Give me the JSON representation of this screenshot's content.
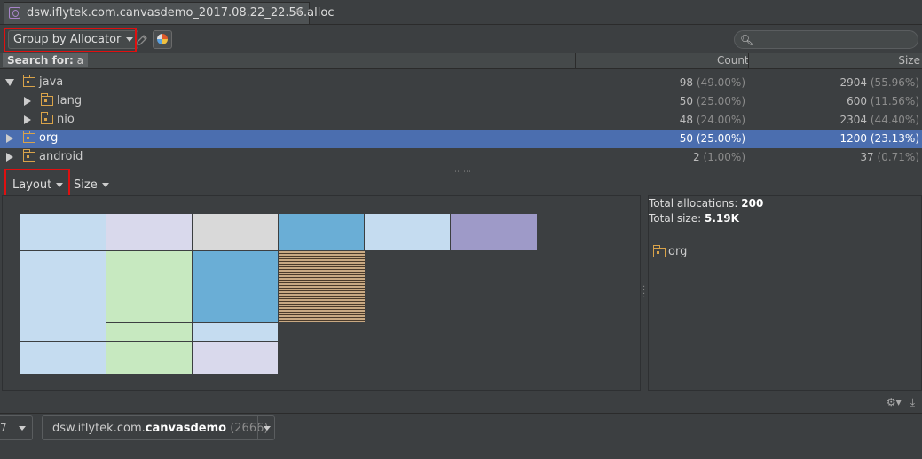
{
  "tab": {
    "title": "dsw.iflytek.com.canvasdemo_2017.08.22_22.56.alloc",
    "close_glyph": "×"
  },
  "toolbar": {
    "group_by_label": "Group by Allocator"
  },
  "table": {
    "search_prefix": "Search for:",
    "search_query": "a",
    "col_count": "Count",
    "col_size": "Size",
    "rows": [
      {
        "name": "java",
        "expanded": true,
        "count": "98",
        "count_pct": "(49.00%)",
        "size": "2904",
        "size_pct": "(55.96%)"
      },
      {
        "name": "lang",
        "expanded": false,
        "count": "50",
        "count_pct": "(25.00%)",
        "size": "600",
        "size_pct": "(11.56%)"
      },
      {
        "name": "nio",
        "expanded": false,
        "count": "48",
        "count_pct": "(24.00%)",
        "size": "2304",
        "size_pct": "(44.40%)"
      },
      {
        "name": "org",
        "expanded": false,
        "selected": true,
        "count": "50",
        "count_pct": "(25.00%)",
        "size": "1200",
        "size_pct": "(23.13%)"
      },
      {
        "name": "android",
        "expanded": false,
        "count": "2",
        "count_pct": "(1.00%)",
        "size": "37",
        "size_pct": "(0.71%)"
      }
    ]
  },
  "chart_toolbar": {
    "layout_label": "Layout",
    "size_label": "Size"
  },
  "info": {
    "alloc_label": "Total allocations:",
    "alloc_value": "200",
    "size_label": "Total size:",
    "size_value": "5.19K",
    "package": "org"
  },
  "status": {
    "device_text": "7",
    "process_prefix": "dsw.iflytek.com.",
    "process_bold": "canvasdemo",
    "process_pid": "(2666)"
  },
  "colors": {
    "light_blue": "#c5dcf0",
    "lavender": "#d9d9ec",
    "gray": "#d9d9d9",
    "mid_blue": "#6aaed6",
    "purple": "#9e9ac8",
    "light_green": "#c7e9c0",
    "highlight": "#4b6eaf"
  }
}
